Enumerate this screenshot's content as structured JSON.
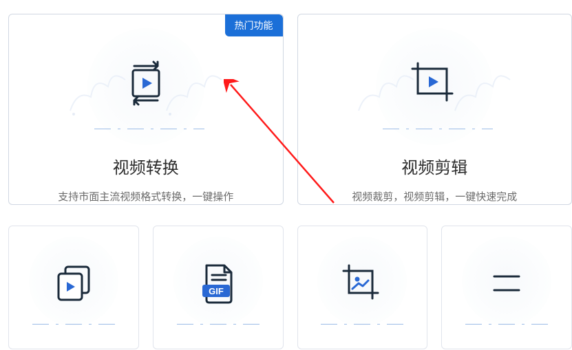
{
  "badge": "热门功能",
  "cards": {
    "large": [
      {
        "title": "视频转换",
        "desc": "支持市面主流视频格式转换，一键操作",
        "hot": true
      },
      {
        "title": "视频剪辑",
        "desc": "视频裁剪，视频剪辑，一键快速完成",
        "hot": false
      }
    ]
  },
  "icons": {
    "convert": "convert-icon",
    "edit": "crop-play-icon",
    "video_files": "video-files-icon",
    "gif": "gif-file-icon",
    "image_crop": "image-crop-icon",
    "gif_label": "GIF"
  }
}
